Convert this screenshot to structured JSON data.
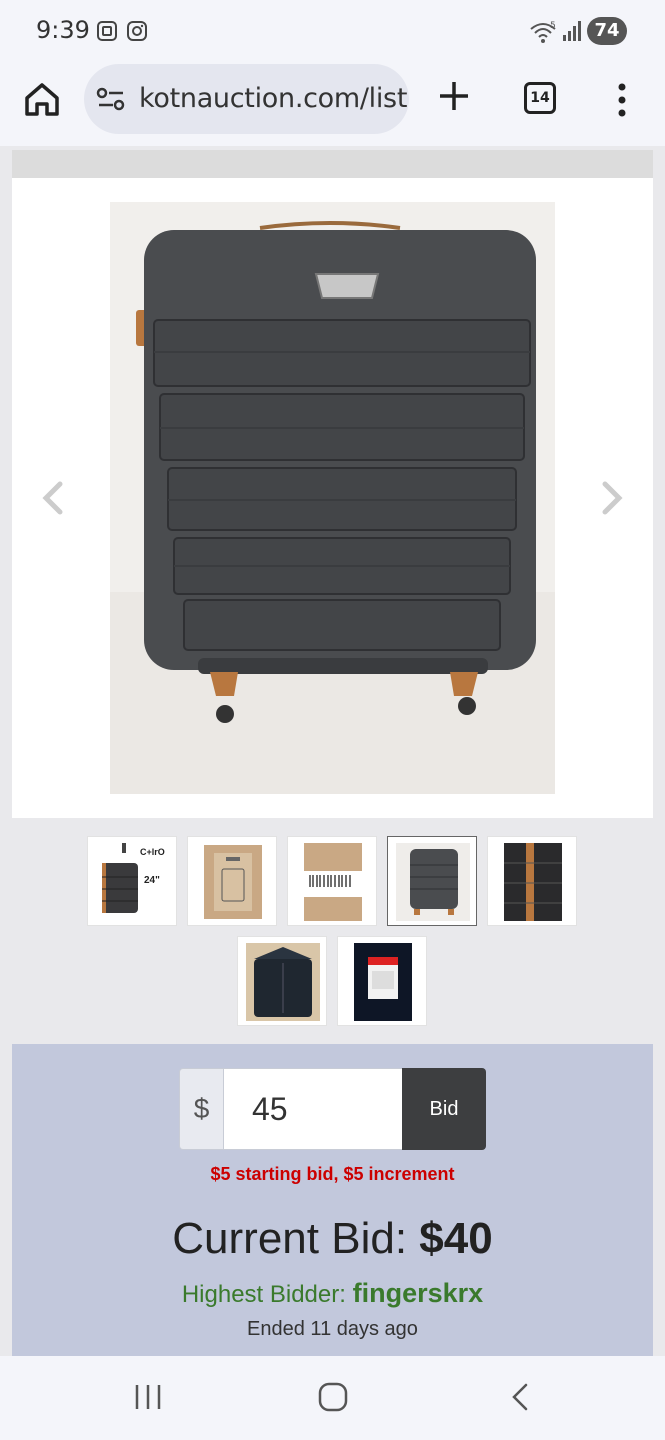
{
  "status": {
    "time": "9:39",
    "battery": "74",
    "wifi_badge": "5"
  },
  "browser": {
    "url": "kotnauction.com/listi",
    "tab_count": "14"
  },
  "carousel": {
    "prev_label": "previous photo",
    "next_label": "next photo"
  },
  "thumbnails": [
    {
      "name": "thumb-luggage-front",
      "active": false
    },
    {
      "name": "thumb-box",
      "active": false
    },
    {
      "name": "thumb-label",
      "active": false
    },
    {
      "name": "thumb-main",
      "active": true
    },
    {
      "name": "thumb-side",
      "active": false
    },
    {
      "name": "thumb-interior",
      "active": false
    },
    {
      "name": "thumb-tag",
      "active": false
    }
  ],
  "thumb_text": {
    "brand": "C+lrO",
    "size": "24\""
  },
  "bid": {
    "currency_symbol": "$",
    "input_value": "45",
    "button_label": "Bid",
    "note": "$5 starting bid, $5 increment",
    "current_label": "Current Bid:",
    "current_value": "$40",
    "bidder_label": "Highest Bidder:",
    "bidder_name": "fingerskrx",
    "ended_text": "Ended 11 days ago"
  },
  "colors": {
    "accent_green": "#3a7a2c",
    "note_red": "#cc0000",
    "panel": "#c2c8dc",
    "bid_button": "#3d3e40"
  }
}
